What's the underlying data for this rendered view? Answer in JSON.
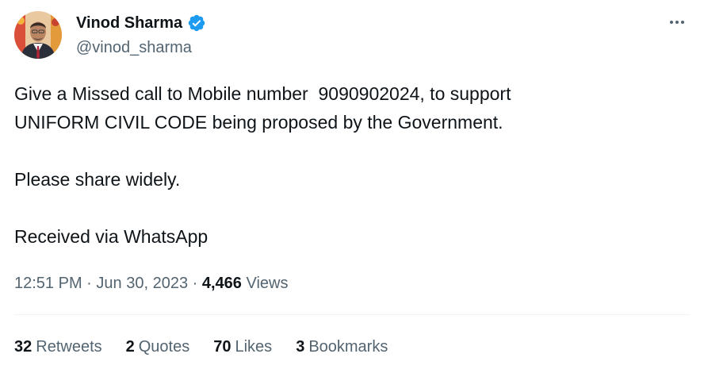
{
  "author": {
    "name": "Vinod Sharma",
    "handle": "@vinod_sharma",
    "verified": true,
    "verified_color": "#1d9bf0"
  },
  "tweet": {
    "paragraphs": [
      "Give a Missed call to Mobile number  9090902024, to support",
      "UNIFORM CIVIL CODE being proposed by the Government.",
      "",
      "Please share widely.",
      "",
      "Received via WhatsApp"
    ],
    "time": "12:51 PM",
    "date": "Jun 30, 2023",
    "separator": "·",
    "views_count": "4,466",
    "views_label": "Views"
  },
  "stats": {
    "retweets": {
      "count": "32",
      "label": "Retweets"
    },
    "quotes": {
      "count": "2",
      "label": "Quotes"
    },
    "likes": {
      "count": "70",
      "label": "Likes"
    },
    "bookmarks": {
      "count": "3",
      "label": "Bookmarks"
    }
  },
  "icons": {
    "more": "more-options-icon",
    "verified": "verified-badge-icon"
  }
}
